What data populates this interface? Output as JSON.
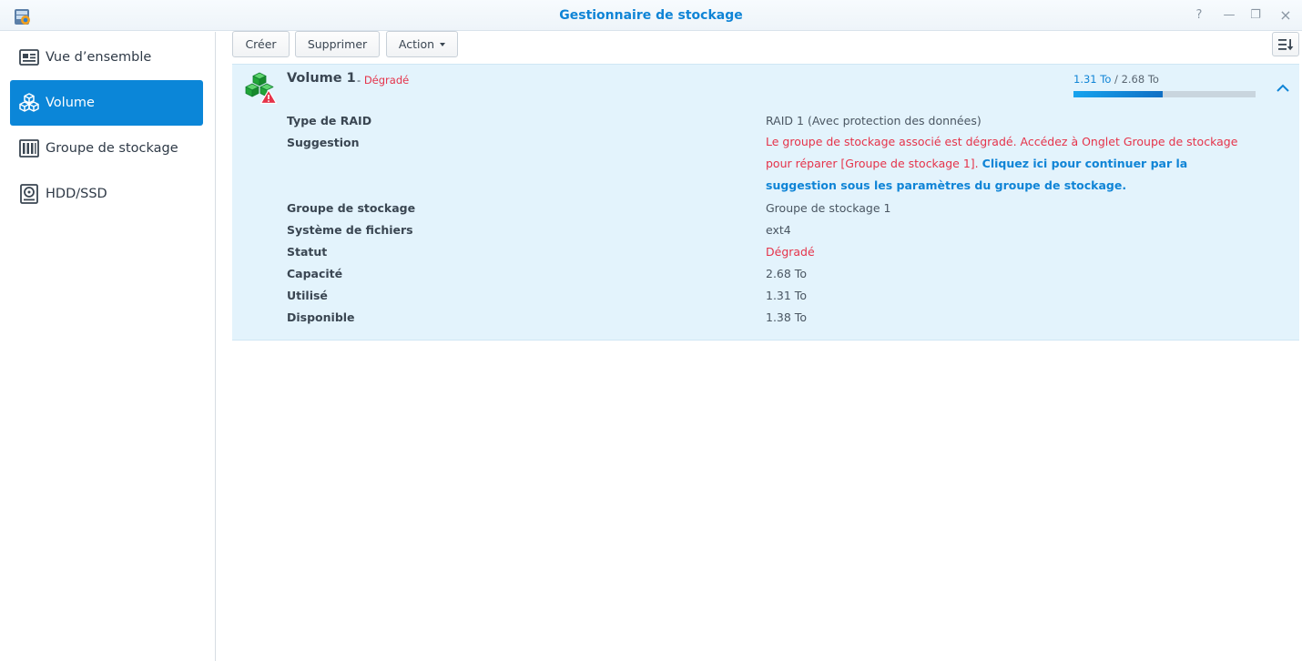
{
  "window": {
    "title": "Gestionnaire de stockage",
    "help_glyph": "?",
    "min_glyph": "—",
    "max_glyph": "❐",
    "close_glyph": "×"
  },
  "sidebar": {
    "items": [
      {
        "label": "Vue d’ensemble",
        "icon": "overview-icon",
        "active": false
      },
      {
        "label": "Volume",
        "icon": "volume-icon",
        "active": true
      },
      {
        "label": "Groupe de stockage",
        "icon": "storage-pool-icon",
        "active": false
      },
      {
        "label": "HDD/SSD",
        "icon": "hdd-icon",
        "active": false
      }
    ]
  },
  "toolbar": {
    "create_label": "Créer",
    "delete_label": "Supprimer",
    "action_label": "Action"
  },
  "volume": {
    "name": "Volume 1",
    "separator": " - ",
    "status": "Dégradé",
    "used": "1.31 To",
    "total": "2.68 To",
    "usage_separator": " / ",
    "usage_fraction": 0.489,
    "props": {
      "raid_type": {
        "label": "Type de RAID",
        "value": "RAID 1 (Avec protection des données)"
      },
      "suggestion": {
        "label": "Suggestion",
        "text": "Le groupe de stockage associé est dégradé. Accédez à Onglet Groupe de stockage pour réparer [Groupe de stockage 1].",
        "link": "Cliquez ici pour continuer par la suggestion sous les paramètres du groupe de stockage."
      },
      "storage_pool": {
        "label": "Groupe de stockage",
        "value": "Groupe de stockage 1"
      },
      "filesystem": {
        "label": "Système de fichiers",
        "value": "ext4"
      },
      "status": {
        "label": "Statut",
        "value": "Dégradé"
      },
      "capacity": {
        "label": "Capacité",
        "value": "2.68 To"
      },
      "used": {
        "label": "Utilisé",
        "value": "1.31 To"
      },
      "available": {
        "label": "Disponible",
        "value": "1.38 To"
      }
    }
  },
  "colors": {
    "accent": "#0b86d8",
    "danger": "#e5334a",
    "card_bg": "#e3f3fc",
    "link": "#0f84d6"
  }
}
